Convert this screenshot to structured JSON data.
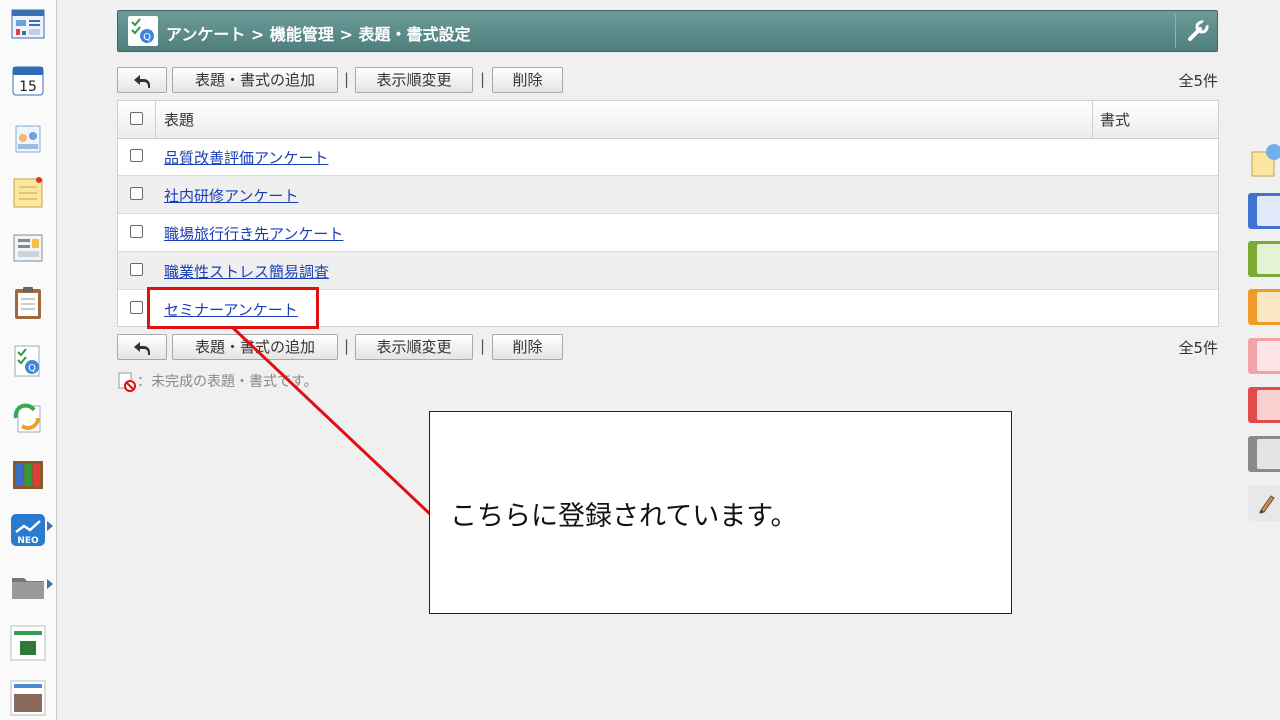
{
  "header": {
    "breadcrumb": "アンケート > 機能管理 > 表題・書式設定"
  },
  "toolbar": {
    "back_label": "",
    "add_label": "表題・書式の追加",
    "reorder_label": "表示順変更",
    "delete_label": "削除",
    "separator": "|",
    "total": "全5件"
  },
  "table": {
    "columns": [
      "表題",
      "書式"
    ],
    "rows": [
      {
        "title": "品質改善評価アンケート"
      },
      {
        "title": "社内研修アンケート"
      },
      {
        "title": "職場旅行行き先アンケート"
      },
      {
        "title": "職業性ストレス簡易調査"
      },
      {
        "title": "セミナーアンケート"
      }
    ]
  },
  "legend": {
    "text": "：未完成の表題・書式です。"
  },
  "annotation": {
    "callout_text": "こちらに登録されています。",
    "highlight_color": "#e01010"
  },
  "sidebar": {
    "calendar_day": "15",
    "neo_label": "NEO"
  },
  "colors": {
    "titlebar": "#5f8e8c",
    "link": "#1a3fb5",
    "palette": [
      "#3f73cf",
      "#7aaa33",
      "#f09a2a",
      "#f2a3a8",
      "#e24b4b",
      "#8a8a8a"
    ]
  }
}
